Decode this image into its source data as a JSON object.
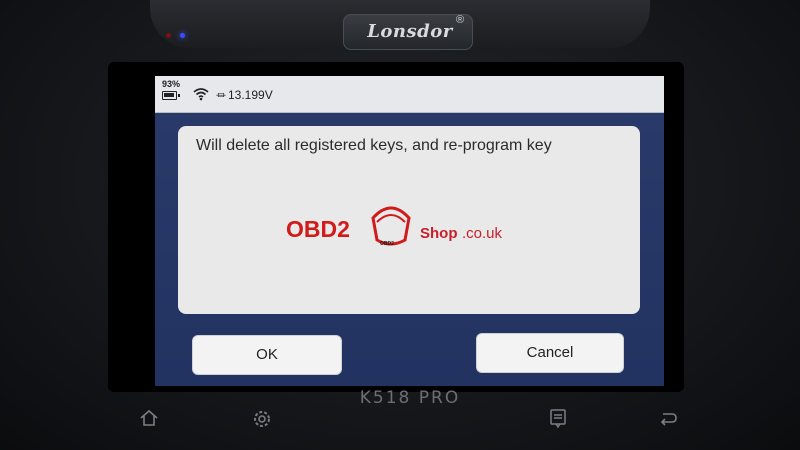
{
  "device": {
    "brand": "Lonsdor",
    "registered_mark": "®",
    "model": "K518 PRO"
  },
  "status_bar": {
    "battery_percent": "93%",
    "wifi_icon": "wifi-icon",
    "voltage": "13.199V"
  },
  "dialog": {
    "message": "Will delete all registered keys, and re-program key",
    "ok_label": "OK",
    "cancel_label": "Cancel"
  },
  "watermark": {
    "brand_red": "OBD2",
    "small_logo_text": "OBD2",
    "shop": "Shop",
    "domain": ".co.uk"
  },
  "nav_keys": [
    "home-icon",
    "settings-icon",
    "menu-icon",
    "back-icon"
  ],
  "colors": {
    "screen_bg": "#223261",
    "dialog_bg": "#e9e9ea",
    "watermark_red": "#d11a1a",
    "indicator_blue": "#3a4cff"
  }
}
